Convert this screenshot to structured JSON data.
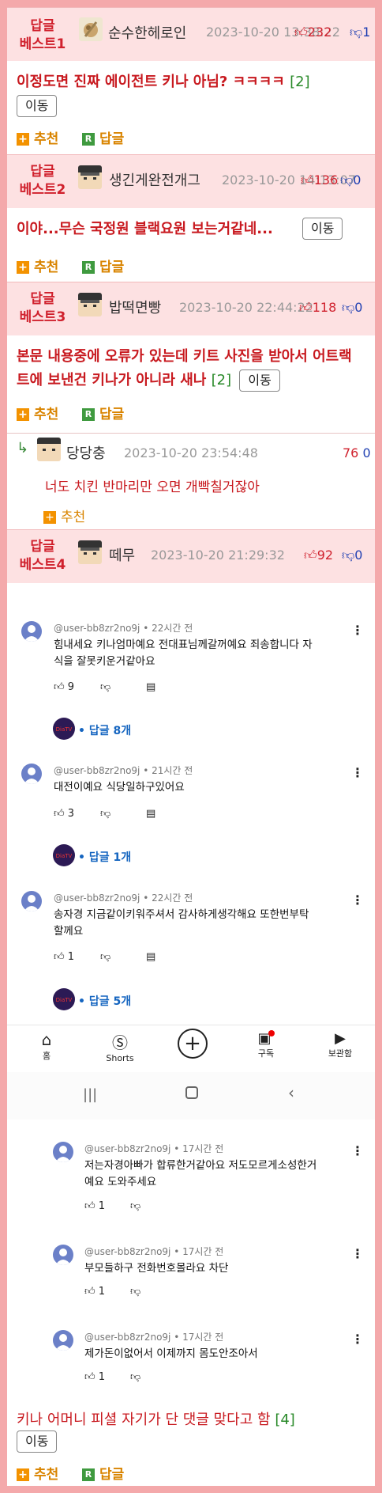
{
  "best1": {
    "badge_line1": "답글",
    "badge_line2": "베스트1",
    "nick": "순수한헤로인",
    "date": "2023-10-20 13:38:22",
    "up": "232",
    "down": "1",
    "title": "이정도면 진짜 에이전트 키나 아님? ㅋㅋㅋㅋ",
    "count": "[2]",
    "move": "이동",
    "recommend": "추천",
    "reply": "답글"
  },
  "best2": {
    "badge_line1": "답글",
    "badge_line2": "베스트2",
    "nick": "생긴게완전개그",
    "date": "2023-10-20 14:13:07",
    "up": "136",
    "down": "0",
    "title": "이야...무슨 국정원 블랙요원 보는거같네...",
    "move": "이동",
    "recommend": "추천",
    "reply": "답글"
  },
  "best3": {
    "badge_line1": "답글",
    "badge_line2": "베스트3",
    "nick": "밥떡면빵",
    "date": "2023-10-20 22:44:22",
    "up": "118",
    "down": "0",
    "title": "본문 내용중에 오류가 있는데 키트 사진을 받아서 어트랙트에 보낸건 키나가 아니라 새나",
    "count": "[2]",
    "move": "이동",
    "recommend": "추천",
    "reply": "답글"
  },
  "sub": {
    "nick": "당당충",
    "date": "2023-10-20 23:54:48",
    "score": "76",
    "score2": "0",
    "text": "너도 치킨 반마리만 오면 개빡칠거잖아",
    "recommend": "추천"
  },
  "best4": {
    "badge_line1": "답글",
    "badge_line2": "베스트4",
    "nick": "떼무",
    "date": "2023-10-20 21:29:32",
    "up": "92",
    "down": "0"
  },
  "yt": {
    "comments": [
      {
        "handle": "@user-bb8zr2no9j • 22시간 전",
        "line1": "힘내세요 키나엄마예요 전대표님께갈꺼예요 죄송합니다 자",
        "line2": "식을 잘못키운거같아요",
        "likes": "9",
        "replies": "• 답글 8개"
      },
      {
        "handle": "@user-bb8zr2no9j • 21시간 전",
        "line1": "대전이예요 식당일하구있어요",
        "line2": "",
        "likes": "3",
        "replies": "• 답글 1개"
      },
      {
        "handle": "@user-bb8zr2no9j • 22시간 전",
        "line1": "송자경 지금같이키워주셔서 감사하게생각해요 또한번부탁",
        "line2": "할께요",
        "likes": "1",
        "replies": "• 답글 5개"
      }
    ],
    "nav": {
      "home": "홈",
      "shorts": "Shorts",
      "subs": "구독",
      "library": "보관함"
    },
    "replies": [
      {
        "handle": "@user-bb8zr2no9j • 17시간 전",
        "line1": "저는자경아빠가 합류한거같아요 저도모르게소성한거",
        "line2": "예요 도와주세요",
        "likes": "1"
      },
      {
        "handle": "@user-bb8zr2no9j • 17시간 전",
        "line1": "부모들하구 전화번호몰라요 차단",
        "line2": "",
        "likes": "1"
      },
      {
        "handle": "@user-bb8zr2no9j • 17시간 전",
        "line1": "제가돈이없어서 이제까지 몸도안조아서",
        "line2": "",
        "likes": "1"
      }
    ],
    "channel_badge": "DiaTV"
  },
  "bottom": {
    "title": "키나 어머니 피셜 자기가 단 댓글 맞다고 함",
    "count": "[4]",
    "move": "이동",
    "recommend": "추천",
    "reply": "답글"
  },
  "colors": {
    "accent_red": "#d0212d",
    "down_blue": "#1f3fb2",
    "recommend_orange": "#f39200",
    "reply_green": "#3f9a3f",
    "frame_pink": "#f4a9ab"
  }
}
